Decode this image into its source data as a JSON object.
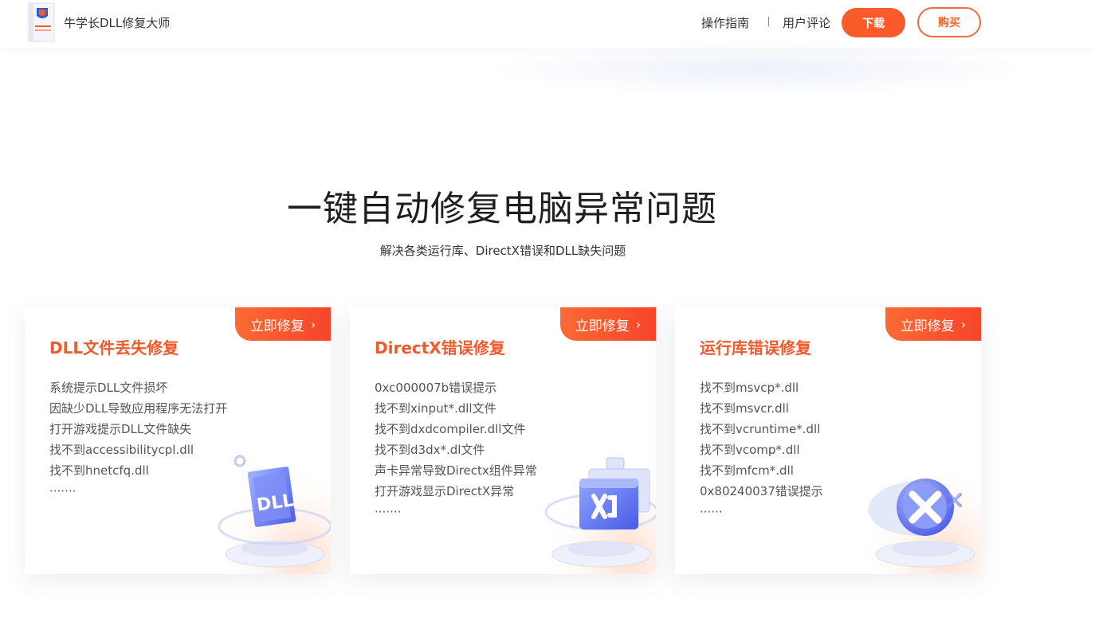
{
  "header": {
    "app_name": "牛学长DLL修复大师",
    "logo_text": "牛学长 DLL修复大师",
    "nav": [
      "操作指南",
      "用户评论"
    ],
    "download_label": "下载",
    "buy_label": "购买"
  },
  "hero": {
    "title": "一键自动修复电脑异常问题",
    "subtitle": "解决各类运行库、DirectX错误和DLL缺失问题"
  },
  "cards": [
    {
      "tag": "立即修复",
      "title": "DLL文件丢失修复",
      "items": [
        "系统提示DLL文件损坏",
        "因缺少DLL导致应用程序无法打开",
        "打开游戏提示DLL文件缺失",
        "找不到accessibilitycpl.dll",
        "找不到hnetcfq.dll",
        "·······"
      ],
      "icon": "dll-file-icon"
    },
    {
      "tag": "立即修复",
      "title": "DirectX错误修复",
      "items": [
        "0xc000007b错误提示",
        "找不到xinput*.dll文件",
        "找不到dxdcompiler.dll文件",
        "找不到d3dx*.dl文件",
        "声卡异常导致Directx组件异常",
        "打开游戏显示DirectX异常",
        "·······"
      ],
      "icon": "directx-window-icon"
    },
    {
      "tag": "立即修复",
      "title": "运行库错误修复",
      "items": [
        "找不到msvcp*.dll",
        "找不到msvcr.dll",
        "找不到vcruntime*.dll",
        "找不到vcomp*.dll",
        "找不到mfcm*.dll",
        "0x80240037错误提示",
        "······"
      ],
      "icon": "runtime-x-icon"
    }
  ],
  "colors": {
    "accent": "#fb5a2b",
    "title_orange": "#f05a2c"
  }
}
